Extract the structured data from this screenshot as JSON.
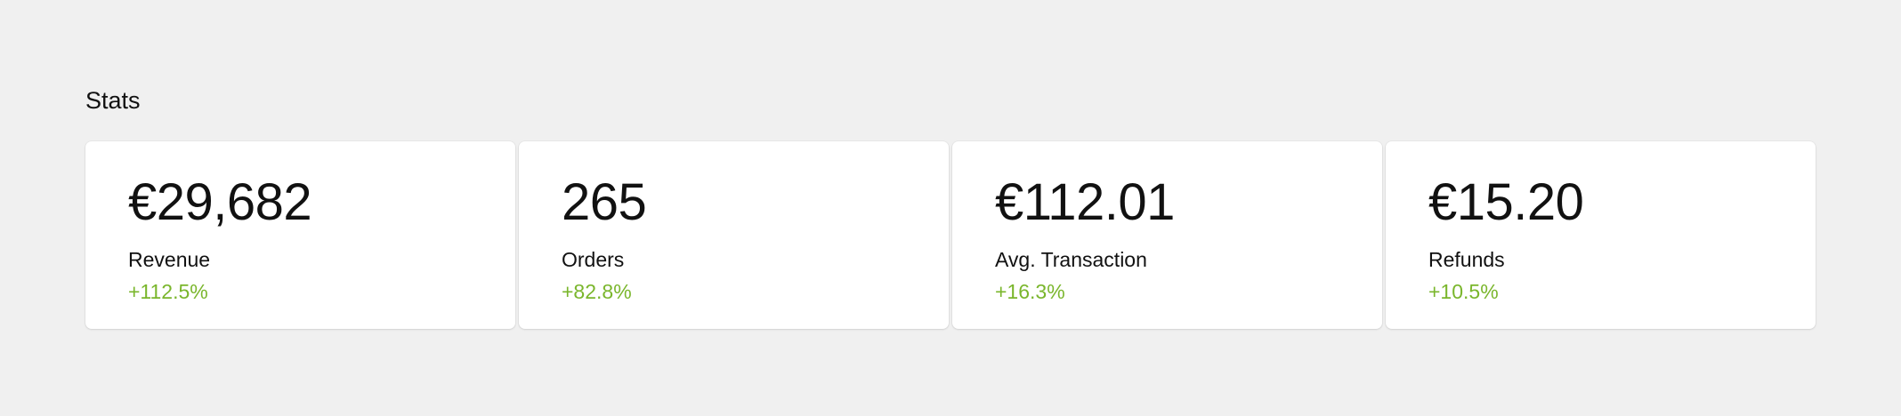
{
  "section": {
    "title": "Stats"
  },
  "colors": {
    "background": "#f0f0f0",
    "card": "#ffffff",
    "positive_change": "#7ab62c",
    "text": "#111111"
  },
  "stats": [
    {
      "value": "€29,682",
      "label": "Revenue",
      "change": "+112.5%"
    },
    {
      "value": "265",
      "label": "Orders",
      "change": "+82.8%"
    },
    {
      "value": "€112.01",
      "label": "Avg. Transaction",
      "change": "+16.3%"
    },
    {
      "value": "€15.20",
      "label": "Refunds",
      "change": "+10.5%"
    }
  ]
}
